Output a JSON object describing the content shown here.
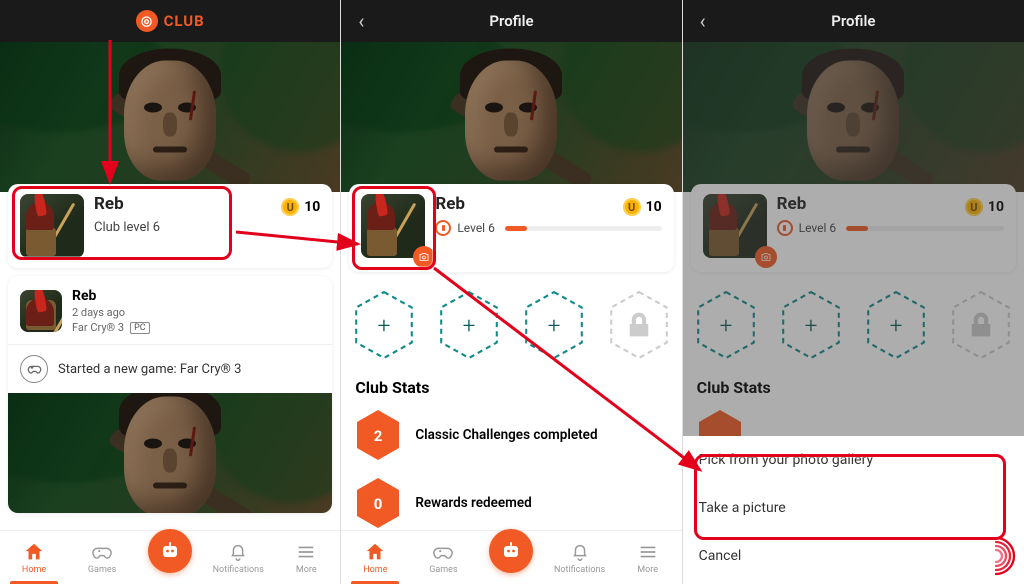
{
  "colors": {
    "accent": "#f15a24",
    "annotate": "#e3001b",
    "coin": "#ffb100"
  },
  "header": {
    "brand": "CLUB",
    "profile_title": "Profile"
  },
  "user": {
    "name": "Reb",
    "club_level_text": "Club level 6",
    "level_text": "Level 6",
    "coins": "10"
  },
  "feed": {
    "name": "Reb",
    "time": "2 days ago",
    "game": "Far Cry® 3",
    "platform": "PC",
    "activity": "Started a new game: Far Cry® 3"
  },
  "hex": {
    "items": [
      "add",
      "add",
      "add",
      "locked"
    ]
  },
  "stats": {
    "title": "Club Stats",
    "rows": [
      {
        "value": "2",
        "label": "Classic Challenges completed"
      },
      {
        "value": "0",
        "label": "Rewards redeemed"
      }
    ]
  },
  "nav": {
    "items": [
      "Home",
      "Games",
      "",
      "Notifications",
      "More"
    ],
    "active": 0
  },
  "sheet": {
    "opt1": "Pick from your photo gallery",
    "opt2": "Take a picture",
    "cancel": "Cancel"
  }
}
